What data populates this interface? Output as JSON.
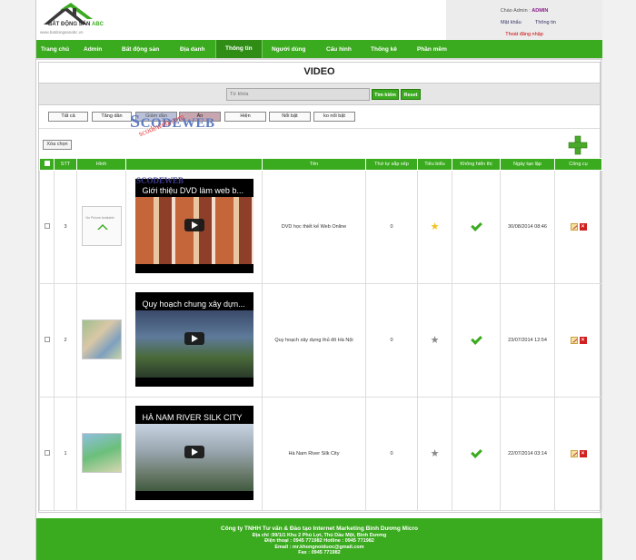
{
  "header": {
    "logo_text_main": "BẤT ĐỘNG SẢN",
    "logo_text_accent": "ABC",
    "logo_url": "www.batdongsanabc.vn",
    "greeting": "Chào Admin :",
    "username": "ADMIN",
    "password_link": "Mật khẩu",
    "info_link": "Thông tin",
    "logout_link": "Thoát đăng nhập"
  },
  "nav": {
    "items": [
      "Trang chủ",
      "Admin",
      "Bất động sản",
      "Địa danh",
      "Thông tin",
      "Người dùng",
      "Cấu hình",
      "Thống kê",
      "Phần mềm"
    ],
    "active_index": 4
  },
  "page": {
    "title": "VIDEO",
    "search_placeholder": "Từ khóa",
    "search_button": "Tìm kiếm",
    "reset_button": "Reset"
  },
  "filters": [
    "Tất cả",
    "Tăng dần",
    "Giảm dần",
    "Ẩn",
    "Hiện",
    "Nổi bật",
    "ko nổi bật"
  ],
  "watermark": {
    "text1_first": "S",
    "text1_rest": "CODEWEB",
    "text2": "scodeweb.com",
    "text3": "SCODEWEB"
  },
  "toolbar": {
    "delete_selected": "Xóa chọn"
  },
  "table": {
    "headers": [
      "STT",
      "Hình",
      "Tên",
      "Thứ tự sắp xếp",
      "Tiêu biểu",
      "Không hiển thị",
      "Ngày tạo lập",
      "Công cụ"
    ],
    "rows": [
      {
        "stt": "3",
        "thumb_text": "No Picture Available",
        "video_title": "Giới thiệu DVD làm web b...",
        "name": "DVD học thiết kế Web Online",
        "order": "0",
        "featured": true,
        "hidden": true,
        "created": "30/08/2014 08:46"
      },
      {
        "stt": "2",
        "thumb_text": "",
        "video_title": "Quy hoạch chung xây dựn...",
        "name": "Quy hoạch xây dựng thủ đô Hà Nội",
        "order": "0",
        "featured": false,
        "hidden": true,
        "created": "23/07/2014 12:54"
      },
      {
        "stt": "1",
        "thumb_text": "",
        "video_title": "HÀ NAM RIVER SILK CITY",
        "name": "Hà Nam River Silk City",
        "order": "0",
        "featured": false,
        "hidden": true,
        "created": "22/07/2014 03:14"
      }
    ]
  },
  "footer": {
    "company": "Công ty TNHH Tư vấn & Đào tạo Internet Marketing Bình Dương Micro",
    "address": "Địa chỉ :99/1/1 Khu 2 Phú Lợi, Thủ Dầu Một, Bình Dương",
    "phone": "Điện thoại : 0945 771982   Hotline : 0945 771982",
    "email": "Email : mr.khongnoiduoc@gmail.com",
    "fax": "Fax : 0945 771982"
  },
  "colors": {
    "brand_green": "#3aaa1e",
    "nav_active": "#2f8d16",
    "delete_red": "#d02020",
    "star_gold": "#f2c21b"
  }
}
